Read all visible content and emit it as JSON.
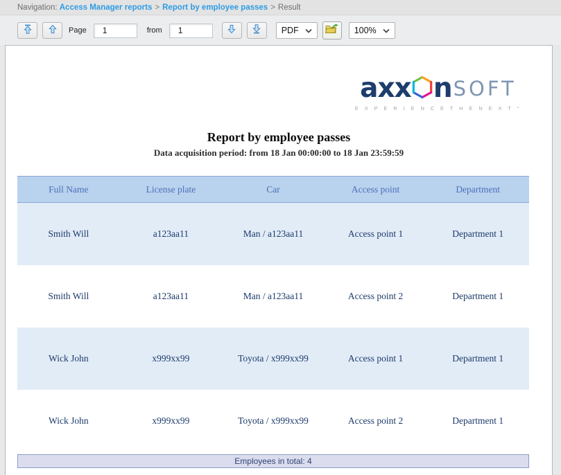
{
  "breadcrumb": {
    "prefix": "Navigation:",
    "link_reports": "Access Manager reports",
    "link_report": "Report by employee passes",
    "separator": ">",
    "current": "Result"
  },
  "toolbar": {
    "page_label": "Page",
    "page_value": "1",
    "from_label": "from",
    "total_pages_value": "1",
    "format_selected": "PDF",
    "zoom_selected": "100%",
    "icons": {
      "first_page": "arrow-up-to-bar",
      "prev_page": "arrow-up",
      "next_page": "arrow-down",
      "last_page": "arrow-down-to-bar",
      "export": "export-folder",
      "format_chevron": "chevron-down",
      "zoom_chevron": "chevron-down"
    }
  },
  "report": {
    "logo": {
      "text_axx": "axx",
      "text_n": "n",
      "text_soft": "SOFT",
      "tagline": "E X P E R I E N C E   T H E   N E X T °",
      "hexagon_icon": "multicolor-hexagon"
    },
    "title": "Report by employee passes",
    "subtitle": "Data acquisition period: from 18 Jan 00:00:00 to 18 Jan 23:59:59",
    "table": {
      "headers": [
        "Full Name",
        "License plate",
        "Car",
        "Access point",
        "Department"
      ],
      "rows": [
        [
          "Smith Will",
          "a123aa11",
          "Man / a123aa11",
          "Access point 1",
          "Department 1"
        ],
        [
          "Smith Will",
          "a123aa11",
          "Man / a123aa11",
          "Access point 2",
          "Department 1"
        ],
        [
          "Wick John",
          "x999xx99",
          "Toyota / x999xx99",
          "Access point 1",
          "Department 1"
        ],
        [
          "Wick John",
          "x999xx99",
          "Toyota / x999xx99",
          "Access point 2",
          "Department 1"
        ]
      ],
      "footer_total": "Employees in total: 4"
    },
    "colors": {
      "link_blue": "#2d9ce3",
      "header_bg": "#b9d2ee",
      "header_text": "#4c70b8",
      "row_alt_bg": "#e2ecf7",
      "cell_text": "#1c3a6a",
      "footer_bg": "#dbddee",
      "footer_border": "#8b9cc7",
      "logo_navy": "#1d3d6d",
      "logo_soft": "#7e95b3"
    }
  }
}
